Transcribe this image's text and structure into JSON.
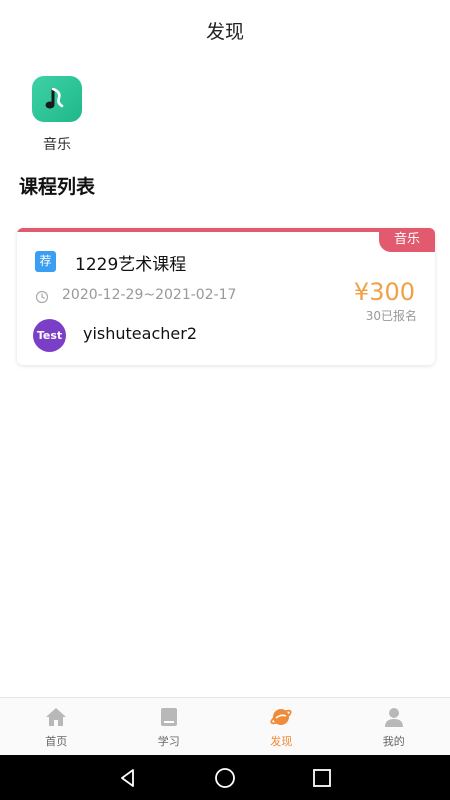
{
  "header": {
    "title": "发现"
  },
  "categories": [
    {
      "label": "音乐",
      "icon": "music-note-icon",
      "color": "#2ec99b"
    }
  ],
  "section_title": "课程列表",
  "courses": [
    {
      "tag": "音乐",
      "badge": "荐",
      "title": "1229艺术课程",
      "dates": "2020-12-29~2021-02-17",
      "price": "¥300",
      "enrolled": "30已报名",
      "avatar_text": "Test",
      "teacher": "yishuteacher2"
    }
  ],
  "bottom_nav": [
    {
      "label": "首页",
      "icon": "home-icon",
      "active": false
    },
    {
      "label": "学习",
      "icon": "book-icon",
      "active": false
    },
    {
      "label": "发现",
      "icon": "planet-icon",
      "active": true
    },
    {
      "label": "我的",
      "icon": "user-icon",
      "active": false
    }
  ],
  "colors": {
    "accent": "#f08b3a",
    "tag": "#e25a6e",
    "price": "#f0a146",
    "badge": "#3a9ff2"
  }
}
